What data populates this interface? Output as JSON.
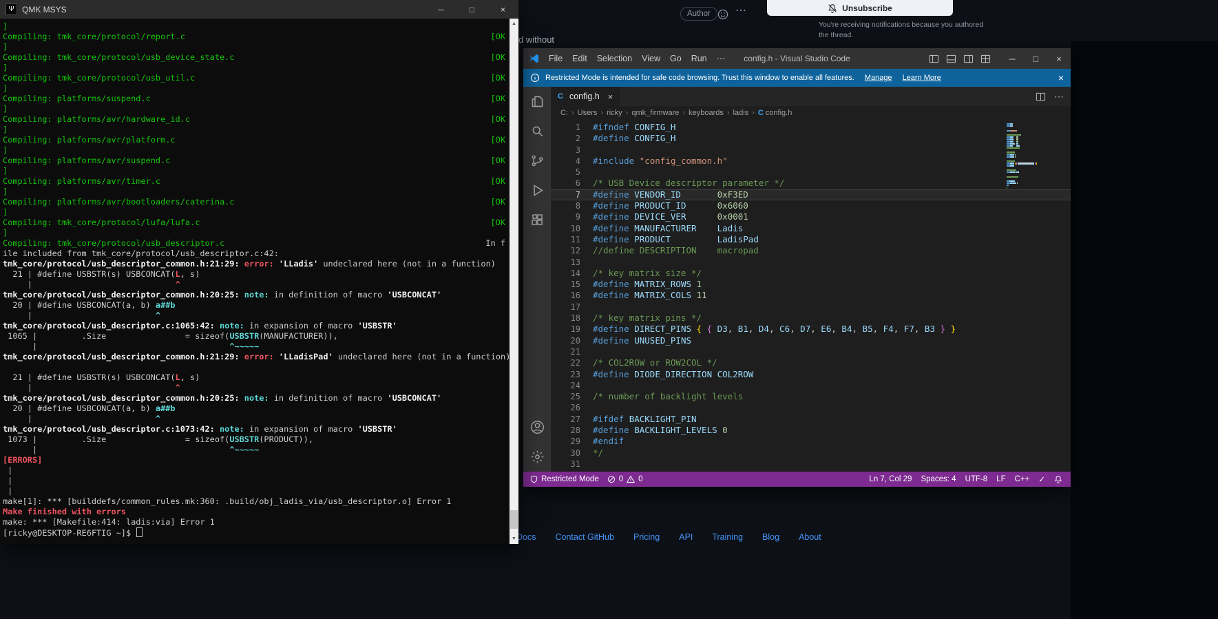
{
  "terminal": {
    "title": "QMK MSYS",
    "lines": [
      {
        "s": [
          [
            "]",
            "g"
          ]
        ]
      },
      {
        "s": [
          [
            "Compiling: tmk_core/protocol/report.c",
            "g"
          ]
        ],
        "r": [
          [
            "[OK",
            "g"
          ]
        ]
      },
      {
        "s": [
          [
            "]",
            "g"
          ]
        ]
      },
      {
        "s": [
          [
            "Compiling: tmk_core/protocol/usb_device_state.c",
            "g"
          ]
        ],
        "r": [
          [
            "[OK",
            "g"
          ]
        ]
      },
      {
        "s": [
          [
            "]",
            "g"
          ]
        ]
      },
      {
        "s": [
          [
            "Compiling: tmk_core/protocol/usb_util.c",
            "g"
          ]
        ],
        "r": [
          [
            "[OK",
            "g"
          ]
        ]
      },
      {
        "s": [
          [
            "]",
            "g"
          ]
        ]
      },
      {
        "s": [
          [
            "Compiling: platforms/suspend.c",
            "g"
          ]
        ],
        "r": [
          [
            "[OK",
            "g"
          ]
        ]
      },
      {
        "s": [
          [
            "]",
            "g"
          ]
        ]
      },
      {
        "s": [
          [
            "Compiling: platforms/avr/hardware_id.c",
            "g"
          ]
        ],
        "r": [
          [
            "[OK",
            "g"
          ]
        ]
      },
      {
        "s": [
          [
            "]",
            "g"
          ]
        ]
      },
      {
        "s": [
          [
            "Compiling: platforms/avr/platform.c",
            "g"
          ]
        ],
        "r": [
          [
            "[OK",
            "g"
          ]
        ]
      },
      {
        "s": [
          [
            "]",
            "g"
          ]
        ]
      },
      {
        "s": [
          [
            "Compiling: platforms/avr/suspend.c",
            "g"
          ]
        ],
        "r": [
          [
            "[OK",
            "g"
          ]
        ]
      },
      {
        "s": [
          [
            "]",
            "g"
          ]
        ]
      },
      {
        "s": [
          [
            "Compiling: platforms/avr/timer.c",
            "g"
          ]
        ],
        "r": [
          [
            "[OK",
            "g"
          ]
        ]
      },
      {
        "s": [
          [
            "]",
            "g"
          ]
        ]
      },
      {
        "s": [
          [
            "Compiling: platforms/avr/bootloaders/caterina.c",
            "g"
          ]
        ],
        "r": [
          [
            "[OK",
            "g"
          ]
        ]
      },
      {
        "s": [
          [
            "]",
            "g"
          ]
        ]
      },
      {
        "s": [
          [
            "Compiling: tmk_core/protocol/lufa/lufa.c",
            "g"
          ]
        ],
        "r": [
          [
            "[OK",
            "g"
          ]
        ]
      },
      {
        "s": [
          [
            "]",
            "g"
          ]
        ]
      },
      {
        "s": [
          [
            "Compiling: tmk_core/protocol/usb_descriptor.c",
            "g"
          ]
        ],
        "r": [
          [
            "In f",
            "w"
          ]
        ]
      },
      {
        "s": [
          [
            "ile included from tmk_core/protocol/usb_descriptor.c:42:",
            "w"
          ]
        ]
      },
      {
        "s": [
          [
            "tmk_core/protocol/usb_descriptor_common.h:21:29:",
            "b"
          ],
          [
            " error: ",
            "r"
          ],
          [
            "'LLadis'",
            "b"
          ],
          [
            " undeclared here (not in a function)",
            "w"
          ]
        ]
      },
      {
        "s": [
          [
            "  21 | #define USBSTR(s) USBCONCAT(",
            "w"
          ],
          [
            "L",
            "r"
          ],
          [
            ", s)",
            "w"
          ]
        ]
      },
      {
        "s": [
          [
            "     |                             ",
            "w"
          ],
          [
            "^",
            "r"
          ]
        ]
      },
      {
        "s": [
          [
            "tmk_core/protocol/usb_descriptor_common.h:20:25:",
            "b"
          ],
          [
            " note: ",
            "c"
          ],
          [
            "in definition of macro ",
            "w"
          ],
          [
            "'USBCONCAT'",
            "b"
          ]
        ]
      },
      {
        "s": [
          [
            "  20 | #define USBCONCAT(a, b) ",
            "w"
          ],
          [
            "a##b",
            "c"
          ]
        ]
      },
      {
        "s": [
          [
            "     |                         ",
            "w"
          ],
          [
            "^",
            "c"
          ]
        ]
      },
      {
        "s": [
          [
            "tmk_core/protocol/usb_descriptor.c:1065:42:",
            "b"
          ],
          [
            " note: ",
            "c"
          ],
          [
            "in expansion of macro ",
            "w"
          ],
          [
            "'USBSTR'",
            "b"
          ]
        ]
      },
      {
        "s": [
          [
            " 1065 |         .Size                = sizeof(",
            "w"
          ],
          [
            "USBSTR",
            "c"
          ],
          [
            "(MANUFACTURER)),",
            "w"
          ]
        ]
      },
      {
        "s": [
          [
            "      |                                       ",
            "w"
          ],
          [
            "^~~~~~",
            "c"
          ]
        ]
      },
      {
        "s": [
          [
            "tmk_core/protocol/usb_descriptor_common.h:21:29:",
            "b"
          ],
          [
            " error: ",
            "r"
          ],
          [
            "'LLadisPad'",
            "b"
          ],
          [
            " undeclared here (not in a function)",
            "w"
          ]
        ]
      },
      {
        "s": []
      },
      {
        "s": [
          [
            "  21 | #define USBSTR(s) USBCONCAT(",
            "w"
          ],
          [
            "L",
            "r"
          ],
          [
            ", s)",
            "w"
          ]
        ]
      },
      {
        "s": [
          [
            "     |                             ",
            "w"
          ],
          [
            "^",
            "r"
          ]
        ]
      },
      {
        "s": [
          [
            "tmk_core/protocol/usb_descriptor_common.h:20:25:",
            "b"
          ],
          [
            " note: ",
            "c"
          ],
          [
            "in definition of macro ",
            "w"
          ],
          [
            "'USBCONCAT'",
            "b"
          ]
        ]
      },
      {
        "s": [
          [
            "  20 | #define USBCONCAT(a, b) ",
            "w"
          ],
          [
            "a##b",
            "c"
          ]
        ]
      },
      {
        "s": [
          [
            "     |                         ",
            "w"
          ],
          [
            "^",
            "c"
          ]
        ]
      },
      {
        "s": [
          [
            "tmk_core/protocol/usb_descriptor.c:1073:42:",
            "b"
          ],
          [
            " note: ",
            "c"
          ],
          [
            "in expansion of macro ",
            "w"
          ],
          [
            "'USBSTR'",
            "b"
          ]
        ]
      },
      {
        "s": [
          [
            " 1073 |         .Size                = sizeof(",
            "w"
          ],
          [
            "USBSTR",
            "c"
          ],
          [
            "(PRODUCT)),",
            "w"
          ]
        ]
      },
      {
        "s": [
          [
            "      |                                       ",
            "w"
          ],
          [
            "^~~~~~",
            "c"
          ]
        ]
      },
      {
        "s": [
          [
            "[ERRORS]",
            "r"
          ]
        ]
      },
      {
        "s": [
          [
            " |",
            "w"
          ]
        ]
      },
      {
        "s": [
          [
            " |",
            "w"
          ]
        ]
      },
      {
        "s": [
          [
            " |",
            "w"
          ]
        ]
      },
      {
        "s": [
          [
            "make[1]: *** [builddefs/common_rules.mk:360: .build/obj_ladis_via/usb_descriptor.o] Error 1",
            "w"
          ]
        ]
      },
      {
        "s": [
          [
            "Make finished with errors",
            "r"
          ]
        ]
      },
      {
        "s": [
          [
            "make: *** [Makefile:414: ladis:via] Error 1",
            "w"
          ]
        ]
      },
      {
        "s": [
          [
            "[ricky@DESKTOP-RE6FTIG ~]$ ",
            "w"
          ],
          [
            "",
            "cur"
          ]
        ]
      }
    ]
  },
  "vscode": {
    "title": "config.h - Visual Studio Code",
    "menus": [
      "File",
      "Edit",
      "Selection",
      "View",
      "Go",
      "Run",
      "⋯"
    ],
    "banner": {
      "text": "Restricted Mode is intended for safe code browsing. Trust this window to enable all features.",
      "manage": "Manage",
      "learn_more": "Learn More"
    },
    "tab": {
      "name": "config.h"
    },
    "breadcrumb": [
      "C:",
      "Users",
      "ricky",
      "qmk_firmware",
      "keyboards",
      "ladis",
      "config.h"
    ],
    "editor": {
      "current_line": 7,
      "lines": [
        [
          [
            "#ifndef ",
            "dir"
          ],
          [
            "CONFIG_H",
            "id"
          ]
        ],
        [
          [
            "#define ",
            "dir"
          ],
          [
            "CONFIG_H",
            "id"
          ]
        ],
        [],
        [
          [
            "#include ",
            "dir"
          ],
          [
            "\"config_common.h\"",
            "str"
          ]
        ],
        [],
        [
          [
            "/* USB Device descriptor parameter */",
            "com"
          ]
        ],
        [
          [
            "#define ",
            "dir"
          ],
          [
            "VENDOR_ID",
            "id"
          ],
          [
            "       ",
            "pun"
          ],
          [
            "0xF3ED",
            "num"
          ]
        ],
        [
          [
            "#define ",
            "dir"
          ],
          [
            "PRODUCT_ID",
            "id"
          ],
          [
            "      ",
            "pun"
          ],
          [
            "0x6060",
            "num"
          ]
        ],
        [
          [
            "#define ",
            "dir"
          ],
          [
            "DEVICE_VER",
            "id"
          ],
          [
            "      ",
            "pun"
          ],
          [
            "0x0001",
            "num"
          ]
        ],
        [
          [
            "#define ",
            "dir"
          ],
          [
            "MANUFACTURER",
            "id"
          ],
          [
            "    ",
            "pun"
          ],
          [
            "Ladis",
            "id"
          ]
        ],
        [
          [
            "#define ",
            "dir"
          ],
          [
            "PRODUCT",
            "id"
          ],
          [
            "         ",
            "pun"
          ],
          [
            "LadisPad",
            "id"
          ]
        ],
        [
          [
            "//define DESCRIPTION    macropad",
            "com"
          ]
        ],
        [],
        [
          [
            "/* key matrix size */",
            "com"
          ]
        ],
        [
          [
            "#define ",
            "dir"
          ],
          [
            "MATRIX_ROWS",
            "id"
          ],
          [
            " ",
            "pun"
          ],
          [
            "1",
            "num"
          ]
        ],
        [
          [
            "#define ",
            "dir"
          ],
          [
            "MATRIX_COLS",
            "id"
          ],
          [
            " ",
            "pun"
          ],
          [
            "11",
            "num"
          ]
        ],
        [],
        [
          [
            "/* key matrix pins */",
            "com"
          ]
        ],
        [
          [
            "#define ",
            "dir"
          ],
          [
            "DIRECT_PINS",
            "id"
          ],
          [
            " ",
            "pun"
          ],
          [
            "{",
            "b1"
          ],
          [
            " ",
            "pun"
          ],
          [
            "{",
            "b2"
          ],
          [
            " ",
            "pun"
          ],
          [
            "D3",
            "id"
          ],
          [
            ", ",
            "pun"
          ],
          [
            "B1",
            "id"
          ],
          [
            ", ",
            "pun"
          ],
          [
            "D4",
            "id"
          ],
          [
            ", ",
            "pun"
          ],
          [
            "C6",
            "id"
          ],
          [
            ", ",
            "pun"
          ],
          [
            "D7",
            "id"
          ],
          [
            ", ",
            "pun"
          ],
          [
            "E6",
            "id"
          ],
          [
            ", ",
            "pun"
          ],
          [
            "B4",
            "id"
          ],
          [
            ", ",
            "pun"
          ],
          [
            "B5",
            "id"
          ],
          [
            ", ",
            "pun"
          ],
          [
            "F4",
            "id"
          ],
          [
            ", ",
            "pun"
          ],
          [
            "F7",
            "id"
          ],
          [
            ", ",
            "pun"
          ],
          [
            "B3",
            "id"
          ],
          [
            " ",
            "pun"
          ],
          [
            "}",
            "b2"
          ],
          [
            " ",
            "pun"
          ],
          [
            "}",
            "b1"
          ]
        ],
        [
          [
            "#define ",
            "dir"
          ],
          [
            "UNUSED_PINS",
            "id"
          ]
        ],
        [],
        [
          [
            "/* COL2ROW or ROW2COL */",
            "com"
          ]
        ],
        [
          [
            "#define ",
            "dir"
          ],
          [
            "DIODE_DIRECTION",
            "id"
          ],
          [
            " ",
            "pun"
          ],
          [
            "COL2ROW",
            "id"
          ]
        ],
        [],
        [
          [
            "/* number of backlight levels",
            "com"
          ]
        ],
        [],
        [
          [
            "#ifdef ",
            "dir"
          ],
          [
            "BACKLIGHT_PIN",
            "id"
          ]
        ],
        [
          [
            "#define ",
            "dir"
          ],
          [
            "BACKLIGHT_LEVELS",
            "id"
          ],
          [
            " ",
            "pun"
          ],
          [
            "0",
            "num"
          ]
        ],
        [
          [
            "#endif",
            "dir"
          ]
        ],
        [
          [
            "*/",
            "com"
          ]
        ],
        []
      ]
    },
    "status": {
      "restricted_label": "Restricted Mode",
      "error_count": "0",
      "warning_count": "0",
      "cursor": "Ln 7, Col 29",
      "indent": "Spaces: 4",
      "encoding": "UTF-8",
      "eol": "LF",
      "language": "C++"
    }
  },
  "github": {
    "author_badge": "Author",
    "unsubscribe_label": "Unsubscribe",
    "notification_reason": "You're receiving notifications because you authored the thread.",
    "fragment": "d without",
    "footer_links": [
      "Docs",
      "Contact GitHub",
      "Pricing",
      "API",
      "Training",
      "Blog",
      "About"
    ]
  }
}
